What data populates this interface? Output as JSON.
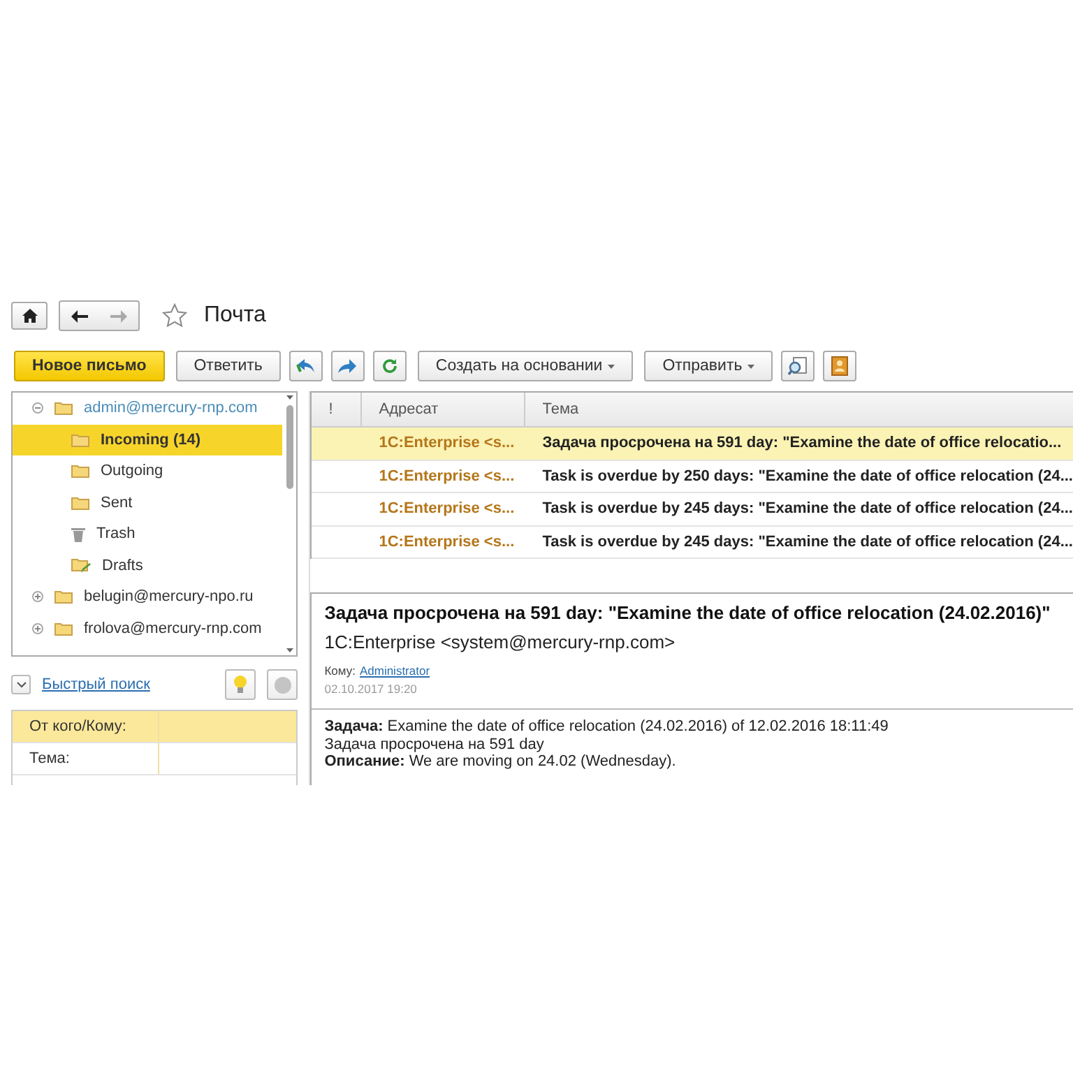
{
  "header": {
    "title": "Почта",
    "favorite": false
  },
  "toolbar": [
    {
      "kind": "primary",
      "label": "Новое письмо"
    },
    {
      "kind": "text",
      "label": "Ответить"
    },
    {
      "kind": "reply_all"
    },
    {
      "kind": "forward"
    },
    {
      "kind": "refresh"
    },
    {
      "kind": "dropdown",
      "label": "Создать на основании"
    },
    {
      "kind": "dropdown",
      "label": "Отправить"
    },
    {
      "kind": "search_doc"
    },
    {
      "kind": "address_book"
    }
  ],
  "folders": [
    {
      "kind": "account",
      "label": "admin@mercury-rnp.com",
      "expanded": true,
      "selected": false,
      "children": [
        {
          "kind": "folder",
          "label": "Incoming (14)",
          "selected": true
        },
        {
          "kind": "folder",
          "label": "Outgoing",
          "selected": false
        },
        {
          "kind": "folder",
          "label": "Sent",
          "selected": false
        },
        {
          "kind": "trash",
          "label": "Trash",
          "selected": false
        },
        {
          "kind": "drafts",
          "label": "Drafts",
          "selected": false
        }
      ]
    },
    {
      "kind": "account",
      "label": "belugin@mercury-npo.ru",
      "expanded": false,
      "selected": false
    },
    {
      "kind": "account",
      "label": "frolova@mercury-rnp.com",
      "expanded": false,
      "selected": false
    }
  ],
  "quick_search": {
    "label": "Быстрый поиск",
    "expanded": false
  },
  "filters": [
    {
      "label": "От кого/Кому:",
      "selected": true
    },
    {
      "label": "Тема:",
      "selected": false
    }
  ],
  "messages": {
    "columns": [
      "!",
      "Адресат",
      "Тема"
    ],
    "rows": [
      {
        "from": "1C:Enterprise <s...",
        "subject": "Задача просрочена на 591 day: \"Examine the date of office relocatio...",
        "selected": true
      },
      {
        "from": "1C:Enterprise <s...",
        "subject": "Task is overdue by 250 days: \"Examine the date of office relocation (24...",
        "selected": false
      },
      {
        "from": "1C:Enterprise <s...",
        "subject": "Task is overdue by 245 days: \"Examine the date of office relocation (24...",
        "selected": false
      },
      {
        "from": "1C:Enterprise <s...",
        "subject": "Task is overdue by 245 days: \"Examine the date of office relocation (24...",
        "selected": false
      }
    ]
  },
  "preview": {
    "subject": "Задача просрочена на 591 day: \"Examine the date of office relocation (24.02.2016)\"",
    "from": "1C:Enterprise <system@mercury-rnp.com>",
    "to_label": "Кому:",
    "to": "Administrator",
    "date": "02.10.2017 19:20",
    "body": [
      "**Задача:** Examine the date of office relocation (24.02.2016) of 12.02.2016 18:11:49",
      "Задача просрочена на 591 day",
      "**Описание:** We are moving on 24.02 (Wednesday)."
    ]
  }
}
